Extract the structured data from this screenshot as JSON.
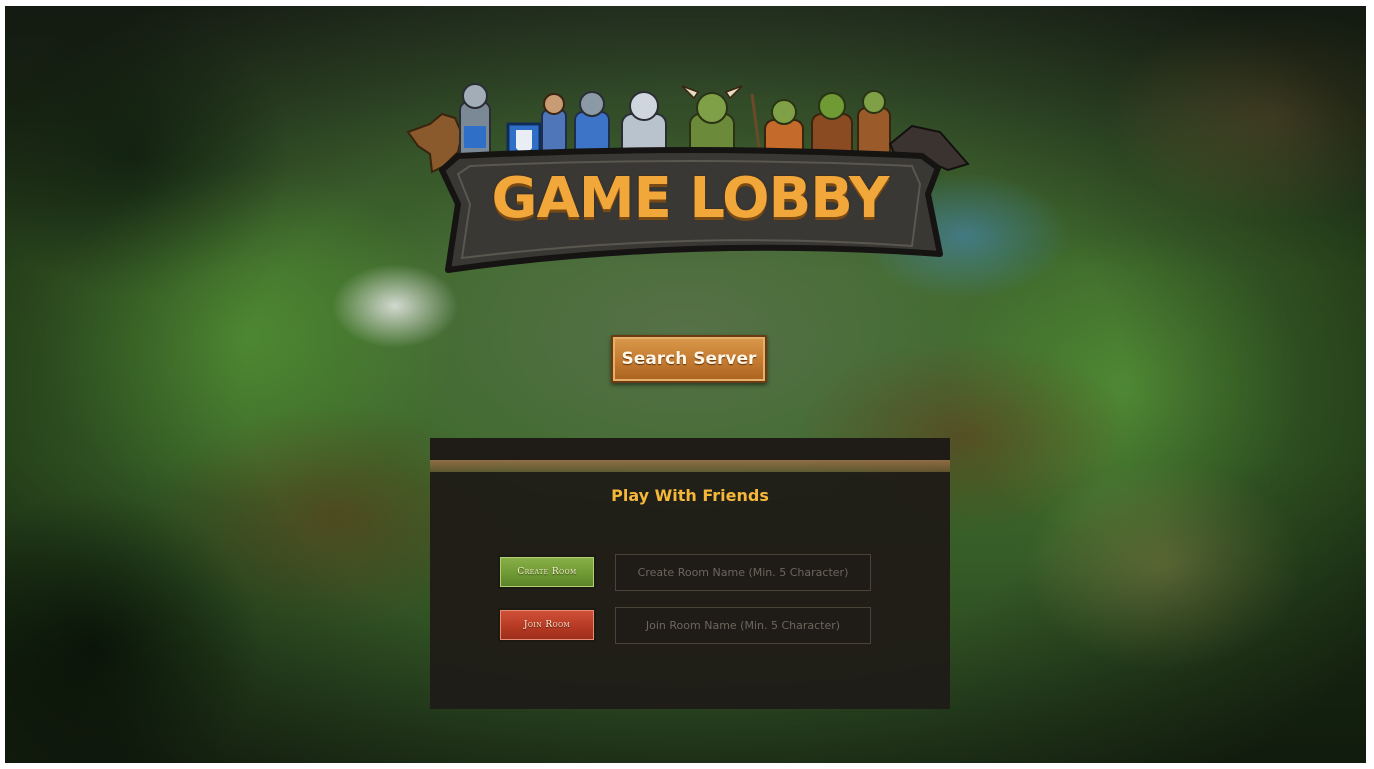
{
  "logo": {
    "title": "GAME LOBBY",
    "title_color": "#f2a73a",
    "banner_color": "#3a3834"
  },
  "lobby": {
    "search_button_label": "Search Server",
    "panel_title": "Play With Friends",
    "create_room_label": "Create Room",
    "create_room_placeholder": "Create Room Name (Min. 5 Character)",
    "join_room_label": "Join Room",
    "join_room_placeholder": "Join Room Name (Min. 5 Character)"
  },
  "colors": {
    "accent_gold": "#f5b73a",
    "create_green": "#6f9a34",
    "join_red": "#b63a24",
    "search_orange": "#c47a30",
    "panel_dark": "#1f1c17"
  }
}
